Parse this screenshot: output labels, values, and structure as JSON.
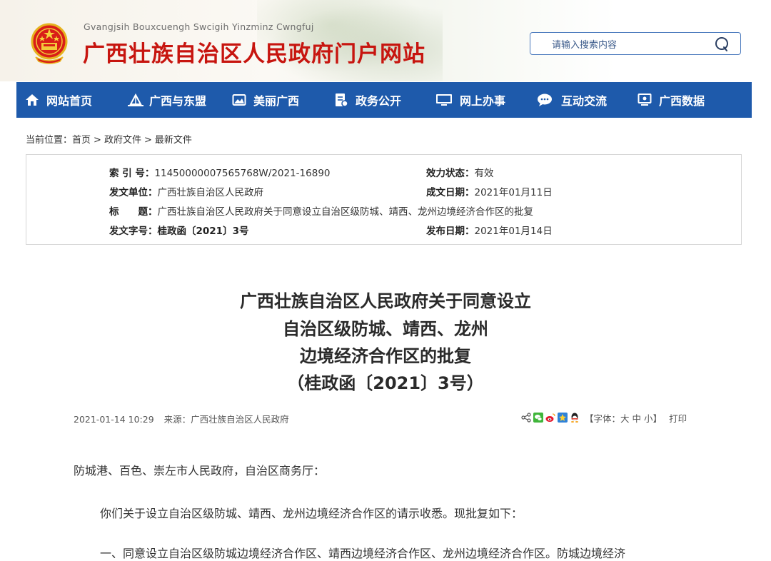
{
  "header": {
    "subtitle": "Gvangjsih Bouxcuengh Swcigih Yinzminz Cwngfuj",
    "title": "广西壮族自治区人民政府门户网站",
    "emblem_icon": "national-emblem-icon"
  },
  "search": {
    "placeholder": "请输入搜索内容",
    "icon": "search-icon"
  },
  "nav": {
    "items": [
      {
        "label": "网站首页",
        "icon": "home-icon"
      },
      {
        "label": "广西与东盟",
        "icon": "landmark-icon"
      },
      {
        "label": "美丽广西",
        "icon": "image-icon"
      },
      {
        "label": "政务公开",
        "icon": "document-icon"
      },
      {
        "label": "网上办事",
        "icon": "computer-icon"
      },
      {
        "label": "互动交流",
        "icon": "chat-icon"
      },
      {
        "label": "广西数据",
        "icon": "monitor-data-icon"
      }
    ],
    "colors": {
      "background": "#1e5aab",
      "text": "#ffffff"
    }
  },
  "breadcrumb": {
    "prefix": "当前位置：",
    "items": [
      "首页",
      "政府文件",
      "最新文件"
    ],
    "separator": ">"
  },
  "meta": {
    "index_label": "索 引 号：",
    "index_value": "11450000007565768W/2021-16890",
    "status_label": "效力状态：",
    "status_value": "有效",
    "issuer_label": "发文单位：",
    "issuer_value": "广西壮族自治区人民政府",
    "created_label": "成文日期：",
    "created_value": "2021年01月11日",
    "subject_label": "标　　题：",
    "subject_value": "广西壮族自治区人民政府关于同意设立自治区级防城、靖西、龙州边境经济合作区的批复",
    "docno_label": "发文字号：",
    "docno_value": "桂政函〔2021〕3号",
    "published_label": "发布日期：",
    "published_value": "2021年01月14日"
  },
  "article": {
    "title_lines": [
      "广西壮族自治区人民政府关于同意设立",
      "自治区级防城、靖西、龙州",
      "边境经济合作区的批复",
      "（桂政函〔2021〕3号）"
    ],
    "datetime": "2021-01-14 10:29",
    "source": "来源：广西壮族自治区人民政府",
    "font_size_prefix": "【字体：",
    "font_large": "大",
    "font_medium": "中",
    "font_small": "小",
    "font_size_suffix": "】",
    "print_label": "打印",
    "share_icons": [
      "share-icon",
      "wechat-icon",
      "weibo-icon",
      "qzone-icon",
      "qq-icon"
    ],
    "paragraphs": [
      "防城港、百色、崇左市人民政府，自治区商务厅：",
      "你们关于设立自治区级防城、靖西、龙州边境经济合作区的请示收悉。现批复如下：",
      "一、同意设立自治区级防城边境经济合作区、靖西边境经济合作区、龙州边境经济合作区。防城边境经济"
    ]
  },
  "colors": {
    "title_red": "#c7150f",
    "accent_blue": "#1e5aab"
  }
}
